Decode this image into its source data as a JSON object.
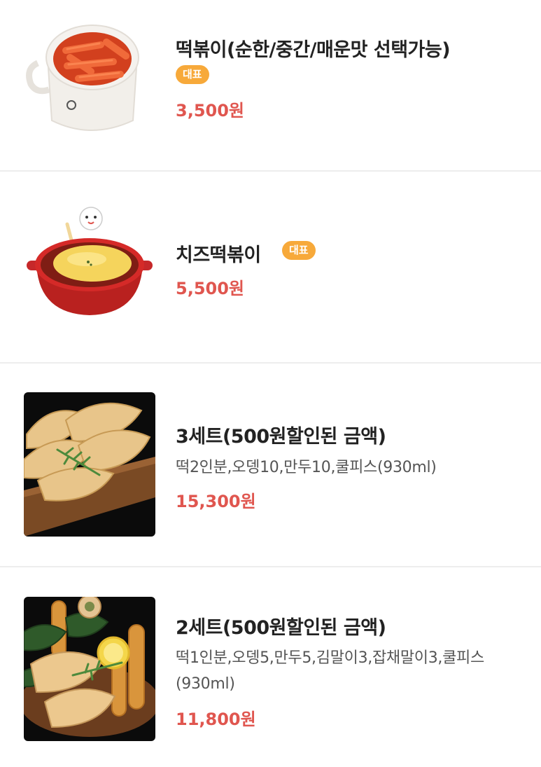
{
  "theme": {
    "price_color": "#e0564f",
    "badge_color": "#f7a93a",
    "divider_color": "#ededed"
  },
  "menu": {
    "items": [
      {
        "name": "떡볶이(순한/중간/매운맛 선택가능)",
        "badge": "대표",
        "price": "3,500원",
        "image_icon": "tteokbokki-cup-photo"
      },
      {
        "name": "치즈떡볶이",
        "badge": "대표",
        "price": "5,500원",
        "image_icon": "cheese-tteokbokki-pot-photo"
      },
      {
        "name": "3세트(500원할인된 금액)",
        "description": "떡2인분,오뎅10,만두10,쿨피스(930ml)",
        "price": "15,300원",
        "image_icon": "fried-dumplings-photo"
      },
      {
        "name": "2세트(500원할인된 금액)",
        "description": "떡1인분,오뎅5,만두5,김말이3,잡채말이3,쿨피스(930ml)",
        "price": "11,800원",
        "image_icon": "fried-platter-photo"
      }
    ]
  }
}
